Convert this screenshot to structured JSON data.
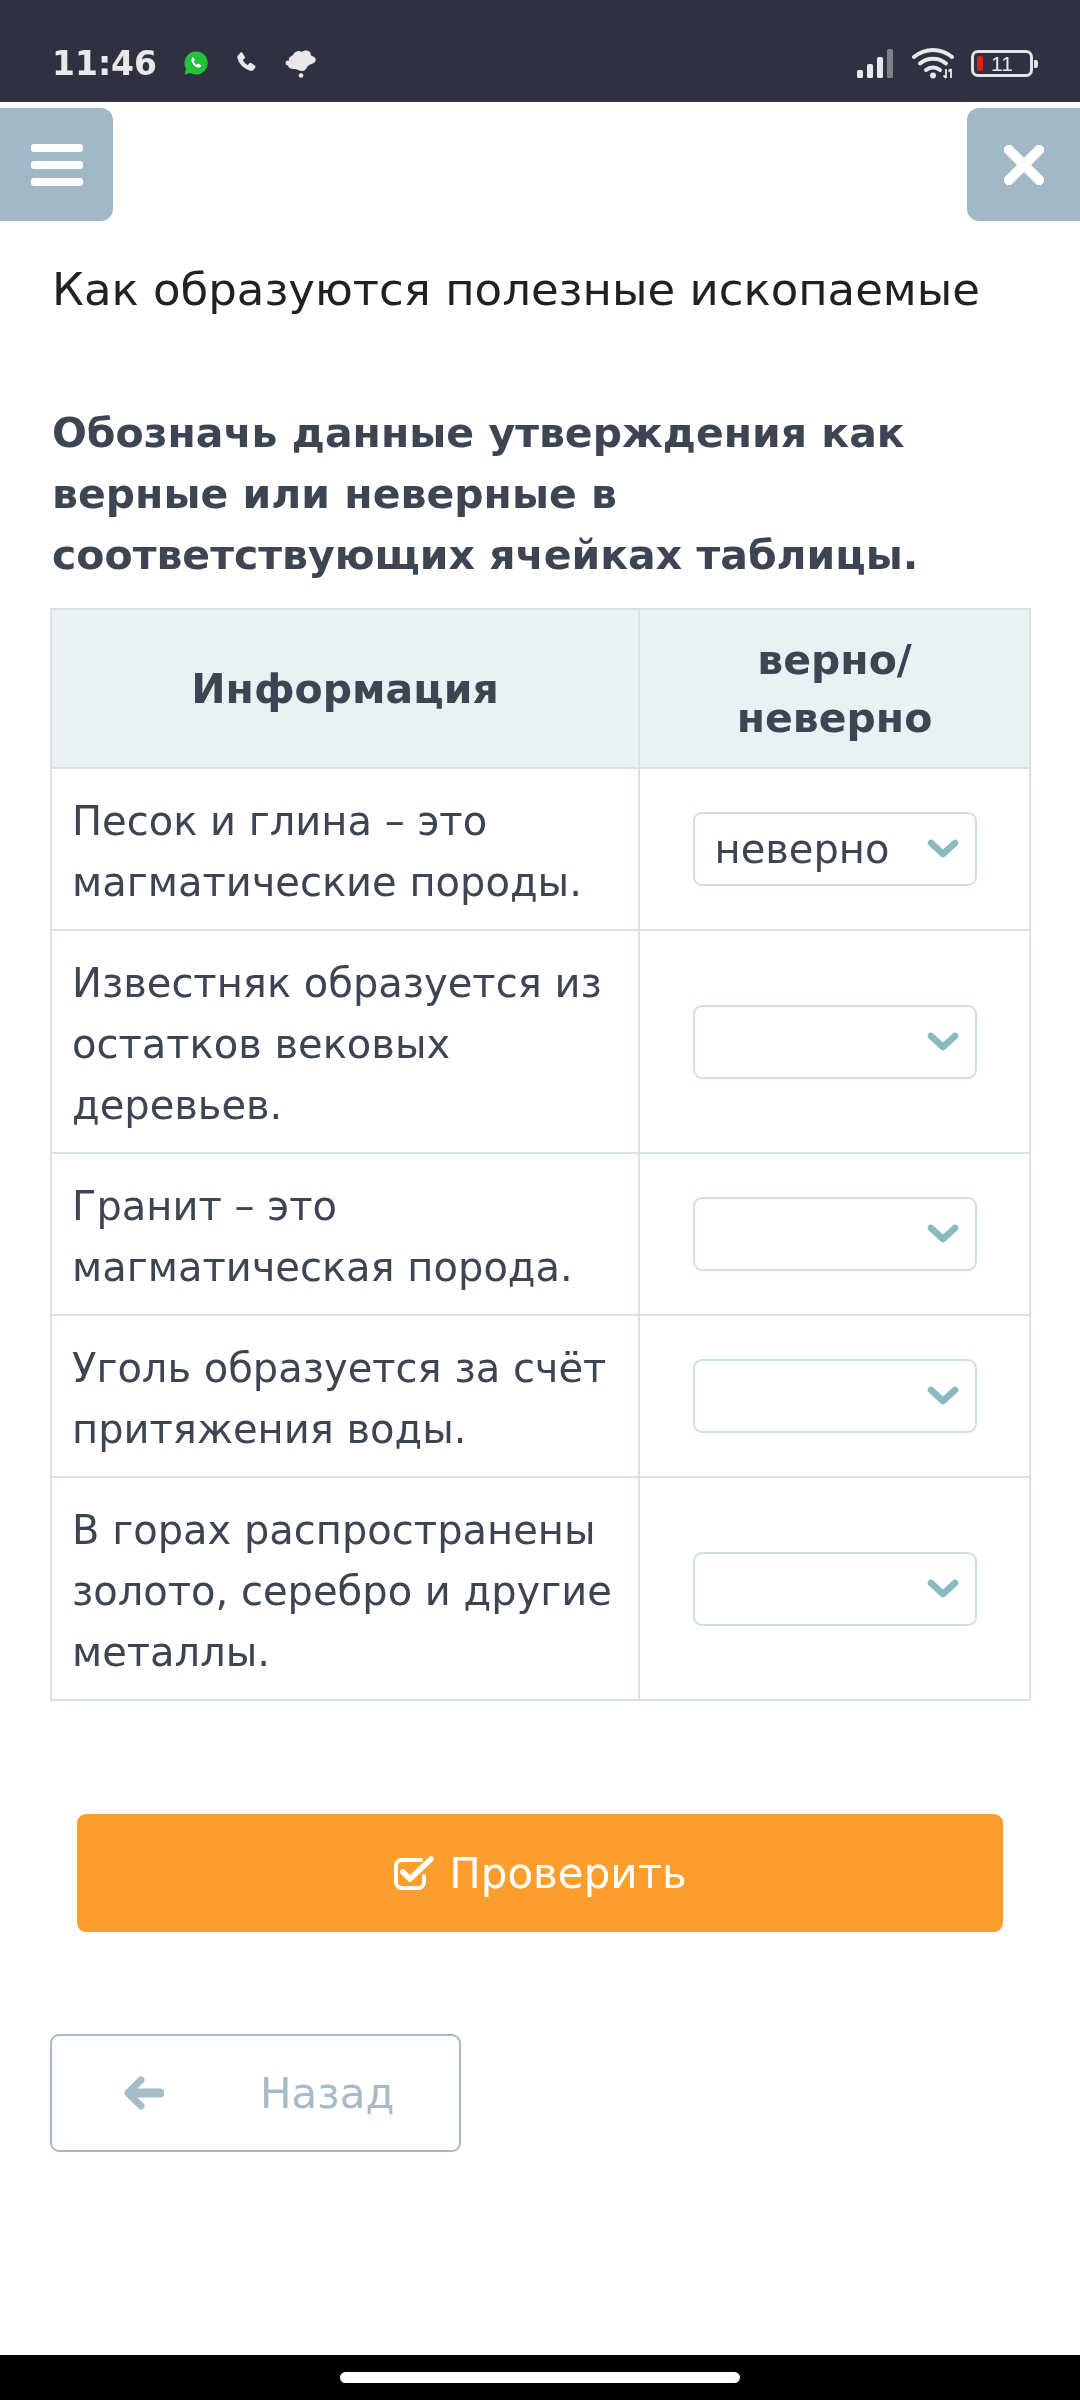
{
  "status_bar": {
    "time": "11:46",
    "battery": "11"
  },
  "lesson_title": "Как образуются полезные ископаемые",
  "task": {
    "instruction": "Обозначь данные утверждения как верные или неверные в соответствующих ячейках таблицы."
  },
  "table": {
    "columns": [
      "Информация",
      "верно/ неверно"
    ],
    "rows": [
      {
        "statement": "Песок и глина – это магматические породы.",
        "answer": "неверно"
      },
      {
        "statement": "Известняк образуется из остатков вековых деревьев."
      },
      {
        "statement": "Гранит – это магматическая порода."
      },
      {
        "statement": "Уголь образуется за счёт притяжения воды."
      },
      {
        "statement": "В горах распространены золото, серебро и другие металлы."
      }
    ]
  },
  "buttons": {
    "check": "Проверить",
    "back": "Назад"
  }
}
